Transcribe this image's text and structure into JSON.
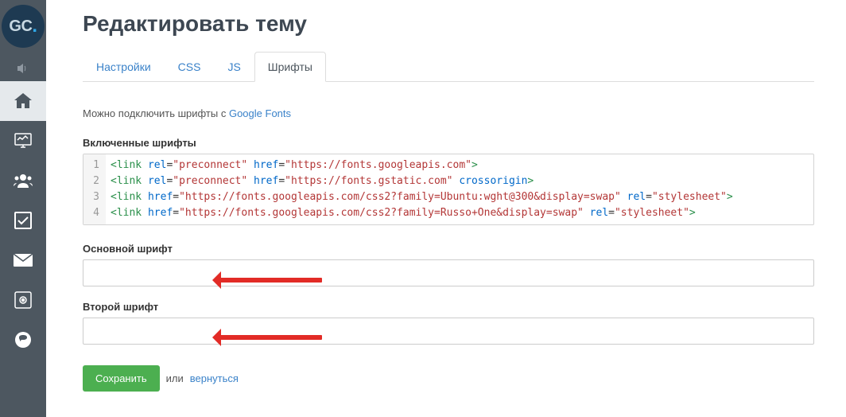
{
  "logo": {
    "text": "GC",
    "dot": "."
  },
  "sidebar": {
    "items": [
      {
        "name": "speaker-icon"
      },
      {
        "name": "home-icon",
        "active": true
      },
      {
        "name": "chart-icon"
      },
      {
        "name": "users-icon"
      },
      {
        "name": "checkbox-icon"
      },
      {
        "name": "mail-icon"
      },
      {
        "name": "safe-icon"
      },
      {
        "name": "chat-icon"
      }
    ]
  },
  "header": {
    "title": "Редактировать тему"
  },
  "tabs": {
    "items": [
      {
        "label": "Настройки"
      },
      {
        "label": "CSS"
      },
      {
        "label": "JS"
      },
      {
        "label": "Шрифты",
        "active": true
      }
    ]
  },
  "info": {
    "prefix": "Можно подключить шрифты с ",
    "link_text": "Google Fonts"
  },
  "code": {
    "label": "Включенные шрифты",
    "lines": [
      {
        "tag_open": "<link",
        "attrs": [
          {
            "n": "rel",
            "v": "preconnect"
          },
          {
            "n": "href",
            "v": "https://fonts.googleapis.com"
          }
        ],
        "tag_close": ">"
      },
      {
        "tag_open": "<link",
        "attrs": [
          {
            "n": "rel",
            "v": "preconnect"
          },
          {
            "n": "href",
            "v": "https://fonts.gstatic.com"
          }
        ],
        "trailing_attr": "crossorigin",
        "tag_close": ">"
      },
      {
        "tag_open": "<link",
        "attrs": [
          {
            "n": "href",
            "v": "https://fonts.googleapis.com/css2?family=Ubuntu:wght@300&display=swap"
          },
          {
            "n": "rel",
            "v": "stylesheet"
          }
        ],
        "tag_close": ">"
      },
      {
        "tag_open": "<link",
        "attrs": [
          {
            "n": "href",
            "v": "https://fonts.googleapis.com/css2?family=Russo+One&display=swap"
          },
          {
            "n": "rel",
            "v": "stylesheet"
          }
        ],
        "tag_close": ">"
      }
    ]
  },
  "fields": {
    "primary_label": "Основной шрифт",
    "primary_value": "",
    "secondary_label": "Второй шрифт",
    "secondary_value": ""
  },
  "actions": {
    "save": "Сохранить",
    "or": "или",
    "return": "вернуться"
  }
}
